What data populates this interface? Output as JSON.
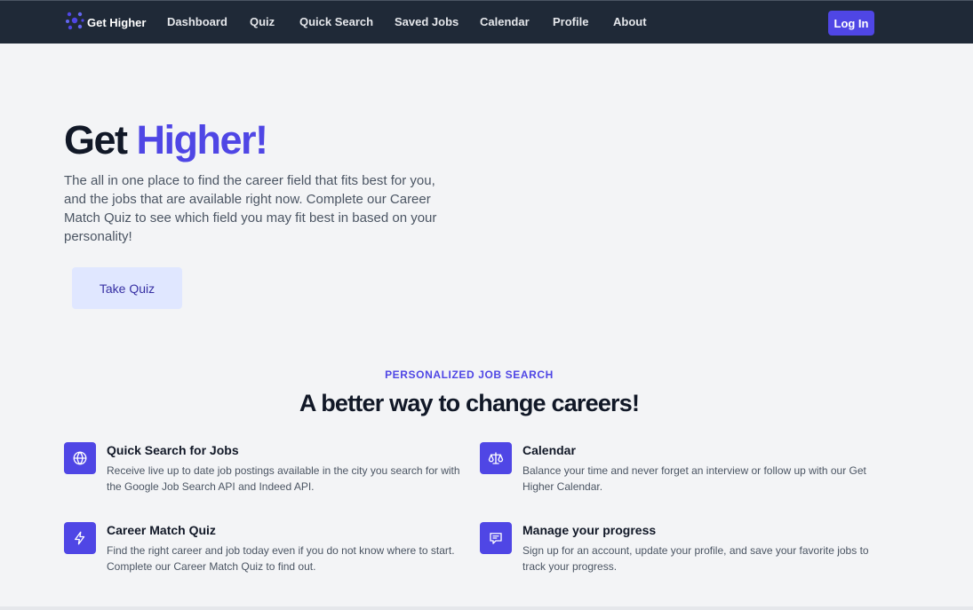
{
  "nav": {
    "brand": "Get Higher",
    "links": [
      "Dashboard",
      "Quiz",
      "Quick Search",
      "Saved Jobs",
      "Calendar",
      "Profile",
      "About"
    ],
    "login": "Log In"
  },
  "hero": {
    "title_plain": "Get",
    "title_accent": "Higher!",
    "description": "The all in one place to find the career field that fits best for you, and the jobs that are available right now. Complete our Career Match Quiz to see which field you may fit best in based on your personality!",
    "cta": "Take Quiz"
  },
  "section": {
    "eyebrow": "PERSONALIZED JOB SEARCH",
    "title": "A better way to change careers!"
  },
  "features": [
    {
      "icon": "globe-icon",
      "title": "Quick Search for Jobs",
      "description": "Receive live up to date job postings available in the city you search for with the Google Job Search API and Indeed API."
    },
    {
      "icon": "scale-icon",
      "title": "Calendar",
      "description": "Balance your time and never forget an interview or follow up with our Get Higher Calendar."
    },
    {
      "icon": "lightning-bolt-icon",
      "title": "Career Match Quiz",
      "description": "Find the right career and job today even if you do not know where to start. Complete our Career Match Quiz to find out."
    },
    {
      "icon": "chat-alt-icon",
      "title": "Manage your progress",
      "description": "Sign up for an account, update your profile, and save your favorite jobs to track your progress."
    }
  ],
  "colors": {
    "nav_bg": "#1f2937",
    "accent": "#4f46e5",
    "page_bg": "#f3f4f6",
    "cta_bg": "#e0e7ff"
  }
}
